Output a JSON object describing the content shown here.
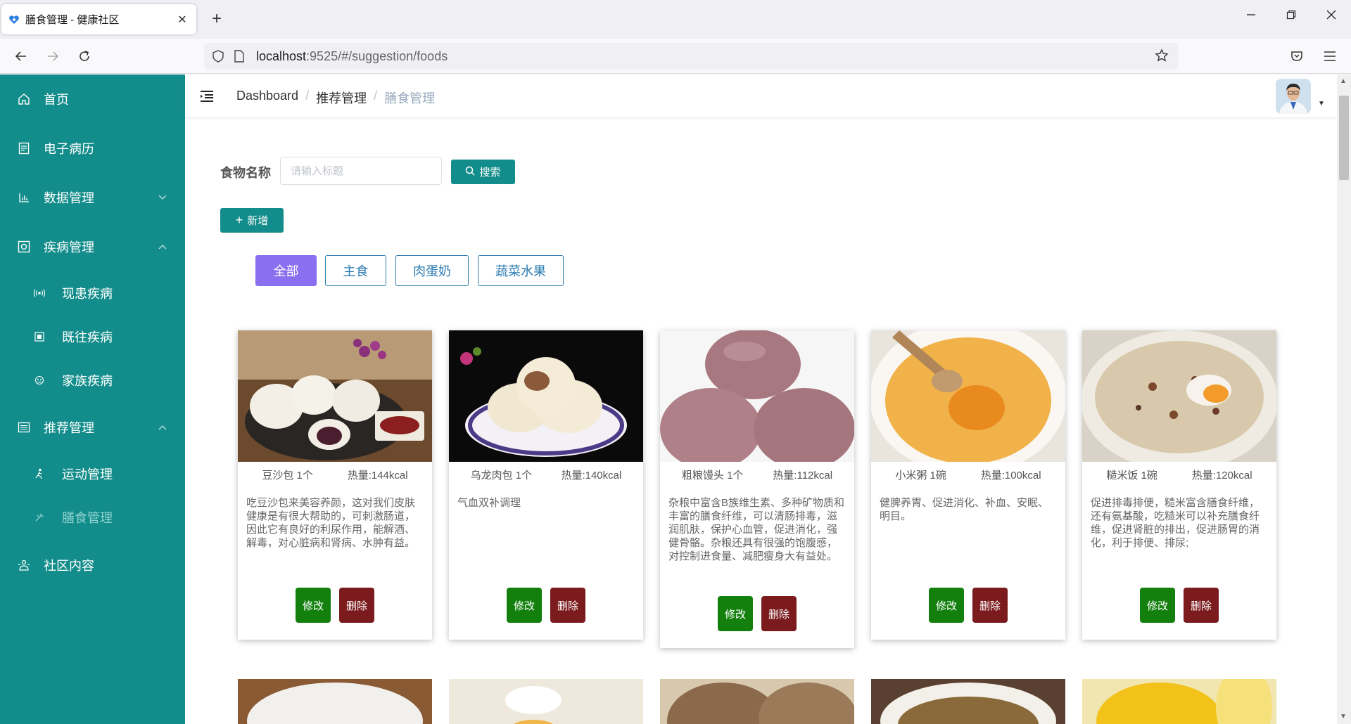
{
  "browser": {
    "tab_title": "膳食管理 - 健康社区",
    "url_host": "localhost",
    "url_rest": ":9525/#/suggestion/foods"
  },
  "sidebar": {
    "items": [
      {
        "label": "首页",
        "icon": "home-icon"
      },
      {
        "label": "电子病历",
        "icon": "document-icon"
      },
      {
        "label": "数据管理",
        "icon": "chart-icon"
      },
      {
        "label": "疾病管理",
        "icon": "medical-icon"
      },
      {
        "label": "现患疾病",
        "icon": "signal-icon"
      },
      {
        "label": "既往疾病",
        "icon": "archive-icon"
      },
      {
        "label": "家族疾病",
        "icon": "family-icon"
      },
      {
        "label": "推荐管理",
        "icon": "list-icon"
      },
      {
        "label": "运动管理",
        "icon": "run-icon"
      },
      {
        "label": "膳食管理",
        "icon": "food-icon"
      },
      {
        "label": "社区内容",
        "icon": "community-icon"
      }
    ]
  },
  "breadcrumb": {
    "b1": "Dashboard",
    "b2": "推荐管理",
    "b3": "膳食管理",
    "sep": "/"
  },
  "search": {
    "label": "食物名称",
    "placeholder": "请输入标题",
    "button": "搜索",
    "add_button": "新增"
  },
  "filters": [
    "全部",
    "主食",
    "肉蛋奶",
    "蔬菜水果"
  ],
  "cards": [
    {
      "name": "豆沙包 1个",
      "calorie": "热量:144kcal",
      "desc": "吃豆沙包来美容养颜，这对我们皮肤健康是有很大帮助的，可刺激肠道，因此它有良好的利尿作用，能解酒、解毒，对心脏病和肾病、水肿有益。",
      "edit": "修改",
      "del": "删除"
    },
    {
      "name": "乌龙肉包 1个",
      "calorie": "热量:140kcal",
      "desc": "气血双补调理",
      "edit": "修改",
      "del": "删除"
    },
    {
      "name": "粗粮馒头 1个",
      "calorie": "热量:112kcal",
      "desc": "杂粮中富含B族维生素、多种矿物质和丰富的膳食纤维，可以清肠排毒，滋润肌肤，保护心血管，促进消化，强健骨骼。杂粮还具有很强的饱腹感，对控制进食量、减肥瘦身大有益处。",
      "edit": "修改",
      "del": "删除"
    },
    {
      "name": "小米粥 1碗",
      "calorie": "热量:100kcal",
      "desc": "健脾养胃、促进消化、补血、安眠、明目。",
      "edit": "修改",
      "del": "删除"
    },
    {
      "name": "糙米饭 1碗",
      "calorie": "热量:120kcal",
      "desc": "促进排毒排便，糙米富含膳食纤维，还有氨基酸，吃糙米可以补充膳食纤维，促进肾脏的排出，促进肠胃的消化，利于排便、排尿;",
      "edit": "修改",
      "del": "删除"
    }
  ]
}
